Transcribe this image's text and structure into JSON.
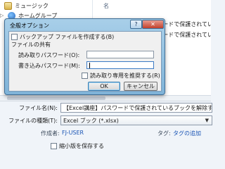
{
  "nav": {
    "items": [
      {
        "label": "ミュージック",
        "icon": "music-folder-icon"
      },
      {
        "label": "ホームグループ",
        "icon": "homegroup-icon"
      }
    ]
  },
  "file_list": {
    "column_header": "名",
    "rows": [
      {
        "name": "【Excel講座】パスワードで保護されてい"
      },
      {
        "name": "【Excel講座】パスワードで保護されてい"
      }
    ]
  },
  "save_form": {
    "filename_label": "ファイル名(N):",
    "filename_value": "【Excel講座】パスワードで保護されているブックを解除するには",
    "filetype_label": "ファイルの種類(T):",
    "filetype_value": "Excel ブック (*.xlsx)",
    "author_label": "作成者:",
    "author_value": "FJ-USER",
    "tag_label": "タグ:",
    "tag_value": "タグの追加",
    "thumbnail_label": "縮小版を保存する"
  },
  "dialog": {
    "title": "全般オプション",
    "help_label": "?",
    "close_label": "✕",
    "backup_label": "バックアップ ファイルを作成する(B)",
    "group_title": "ファイルの共有",
    "read_password_label": "読み取りパスワード(O):",
    "write_password_label": "書き込みパスワード(M):",
    "readonly_label": "読み取り専用を推奨する(R)",
    "ok_label": "OK",
    "cancel_label": "キャンセル"
  }
}
